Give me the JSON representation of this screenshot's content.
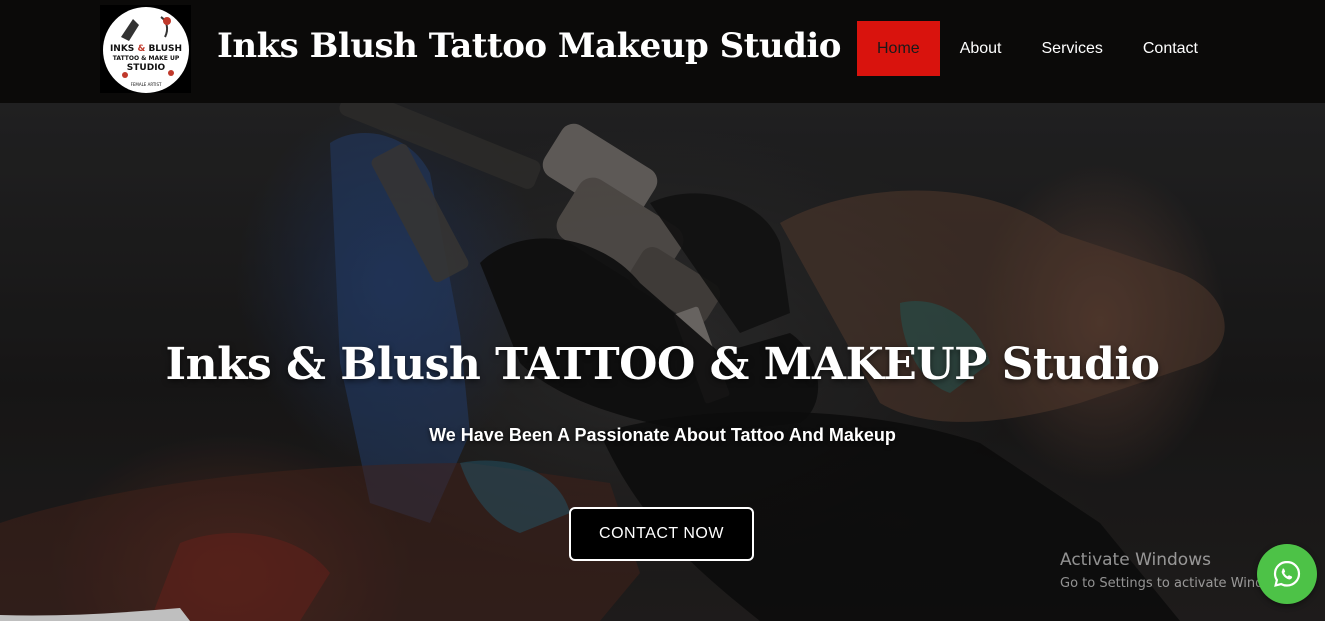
{
  "header": {
    "logo": {
      "line1": "INKS",
      "line1b": "BLUSH",
      "line2": "TATTOO & MAKE UP",
      "line3": "STUDIO",
      "line4": "FEMALE ARTIST"
    },
    "site_title": "Inks Blush Tattoo Makeup Studio"
  },
  "nav": {
    "items": [
      {
        "label": "Home",
        "active": true
      },
      {
        "label": "About",
        "active": false
      },
      {
        "label": "Services",
        "active": false
      },
      {
        "label": "Contact",
        "active": false
      }
    ]
  },
  "hero": {
    "title": "Inks & Blush TATTOO & MAKEUP Studio",
    "subtitle": "We Have Been A Passionate About Tattoo And Makeup",
    "cta_label": "CONTACT NOW"
  },
  "os_watermark": {
    "line1": "Activate Windows",
    "line2": "Go to Settings to activate Windows."
  },
  "floating": {
    "icon": "whatsapp-icon"
  },
  "colors": {
    "header_bg": "#0b0a09",
    "nav_active_bg": "#d9130d",
    "whatsapp": "#4dc247",
    "cta_bg": "#000000"
  }
}
